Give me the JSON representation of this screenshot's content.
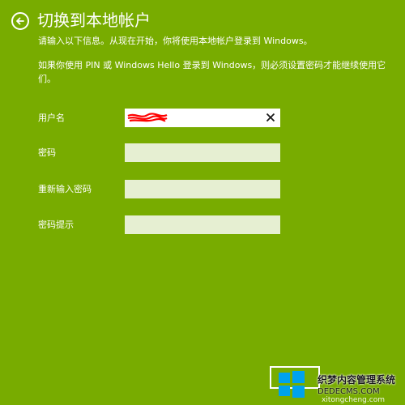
{
  "header": {
    "title": "切换到本地帐户"
  },
  "intro": {
    "line1": "请输入以下信息。从现在开始，你将使用本地帐户登录到 Windows。",
    "line2": "如果你使用 PIN 或 Windows Hello 登录到 Windows，则必须设置密码才能继续使用它们。"
  },
  "form": {
    "username_label": "用户名",
    "username_value": "",
    "password_label": "密码",
    "password_value": "",
    "confirm_label": "重新输入密码",
    "confirm_value": "",
    "hint_label": "密码提示",
    "hint_value": ""
  },
  "watermark": {
    "line1": "织梦内容管理系统",
    "line2": "DEDECMS.COM",
    "line3": "xitongcheng.com"
  },
  "colors": {
    "background": "#78ac00",
    "field_inactive": "#e6efd2",
    "field_active": "#ffffff",
    "redaction": "#ff0000"
  },
  "icons": {
    "back": "back-arrow-icon",
    "clear": "close-icon",
    "watermark": "windows-logo-icon"
  }
}
